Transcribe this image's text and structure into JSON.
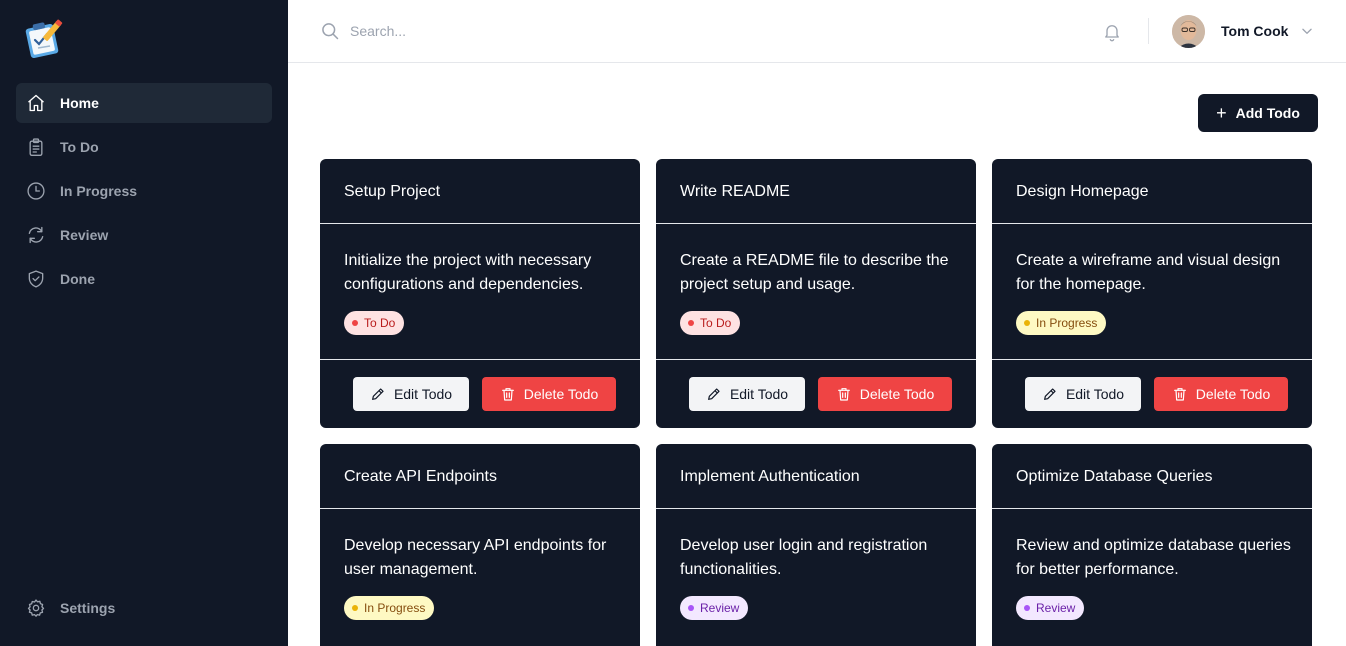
{
  "sidebar": {
    "items": [
      {
        "label": "Home",
        "icon": "home-icon"
      },
      {
        "label": "To Do",
        "icon": "clipboard-icon"
      },
      {
        "label": "In Progress",
        "icon": "clock-icon"
      },
      {
        "label": "Review",
        "icon": "refresh-icon"
      },
      {
        "label": "Done",
        "icon": "shield-check-icon"
      }
    ],
    "settings_label": "Settings"
  },
  "header": {
    "search_placeholder": "Search...",
    "user_name": "Tom Cook"
  },
  "main": {
    "add_button_label": "Add Todo",
    "edit_label": "Edit Todo",
    "delete_label": "Delete Todo",
    "cards": [
      {
        "title": "Setup Project",
        "description": "Initialize the project with necessary configurations and dependencies.",
        "status": "To Do"
      },
      {
        "title": "Write README",
        "description": "Create a README file to describe the project setup and usage.",
        "status": "To Do"
      },
      {
        "title": "Design Homepage",
        "description": "Create a wireframe and visual design for the homepage.",
        "status": "In Progress"
      },
      {
        "title": "Create API Endpoints",
        "description": "Develop necessary API endpoints for user management.",
        "status": "In Progress"
      },
      {
        "title": "Implement Authentication",
        "description": "Develop user login and registration functionalities.",
        "status": "Review"
      },
      {
        "title": "Optimize Database Queries",
        "description": "Review and optimize database queries for better performance.",
        "status": "Review"
      }
    ]
  },
  "colors": {
    "sidebar_bg": "#111827",
    "card_bg": "#111827",
    "delete": "#ef4444"
  }
}
